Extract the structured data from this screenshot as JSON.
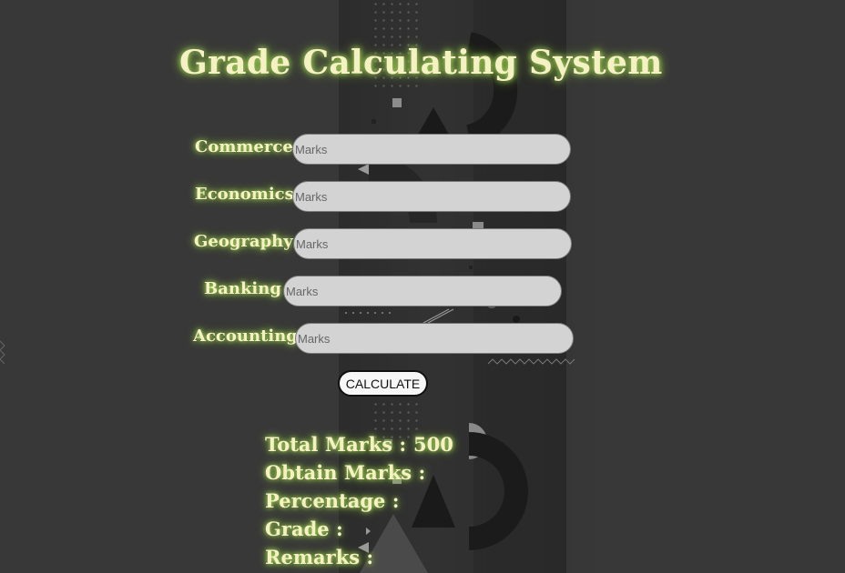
{
  "header": {
    "title": "Grade Calculating System"
  },
  "subjects": [
    {
      "label": "Commerce :",
      "placeholder": "Marks",
      "value": ""
    },
    {
      "label": "Economics :",
      "placeholder": "Marks",
      "value": ""
    },
    {
      "label": "Geography :",
      "placeholder": "Marks",
      "value": ""
    },
    {
      "label": "Banking :",
      "placeholder": "Marks",
      "value": ""
    },
    {
      "label": "Accounting :",
      "placeholder": "Marks",
      "value": ""
    }
  ],
  "calculate_button": {
    "label": "CALCULATE"
  },
  "results": {
    "total_label": "Total Marks :",
    "total_value": "500",
    "obtain_label": "Obtain Marks :",
    "obtain_value": "",
    "percentage_label": "Percentage :",
    "percentage_value": "",
    "grade_label": "Grade :",
    "grade_value": "",
    "remarks_label": "Remarks :",
    "remarks_value": ""
  },
  "colors": {
    "background": "#383838",
    "text": "#f6f1c4",
    "glow": "#8fcf3a",
    "input_bg": "#d3d3d3"
  }
}
